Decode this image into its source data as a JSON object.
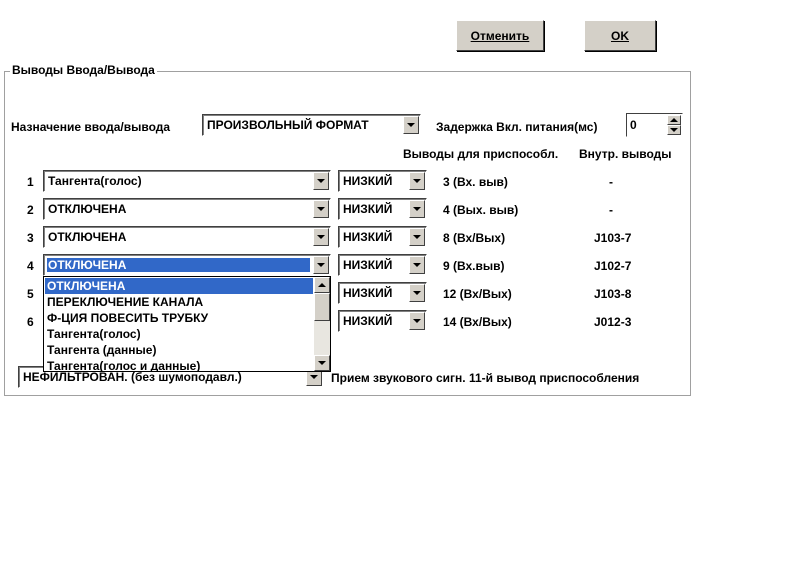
{
  "buttons": {
    "cancel": "Отменить",
    "ok": "OK"
  },
  "group_title": "Выводы Ввода/Вывода",
  "io_purpose": {
    "label": "Назначение ввода/вывода",
    "value": "ПРОИЗВОЛЬНЫЙ ФОРМАТ"
  },
  "power_delay": {
    "label": "Задержка Вкл. питания(мс)",
    "value": "0"
  },
  "headers": {
    "device_pins": "Выводы для приспособл.",
    "internal_pins": "Внутр. выводы"
  },
  "rows": [
    {
      "num": "1",
      "function": "Тангента(голос)",
      "level": "НИЗКИЙ",
      "device_pin": "3  (Вх. выв)",
      "internal_pin": "-"
    },
    {
      "num": "2",
      "function": "ОТКЛЮЧЕНА",
      "level": "НИЗКИЙ",
      "device_pin": "4  (Вых. выв)",
      "internal_pin": "-"
    },
    {
      "num": "3",
      "function": "ОТКЛЮЧЕНА",
      "level": "НИЗКИЙ",
      "device_pin": "8  (Вх/Вых)",
      "internal_pin": "J103-7"
    },
    {
      "num": "4",
      "function": "ОТКЛЮЧЕНА",
      "level": "НИЗКИЙ",
      "device_pin": "9  (Вх.выв)",
      "internal_pin": "J102-7"
    },
    {
      "num": "5",
      "function": "",
      "level": "НИЗКИЙ",
      "device_pin": "12  (Вх/Вых)",
      "internal_pin": "J103-8"
    },
    {
      "num": "6",
      "function": "",
      "level": "НИЗКИЙ",
      "device_pin": "14  (Вх/Вых)",
      "internal_pin": "J012-3"
    }
  ],
  "dropdown": {
    "items": [
      "ОТКЛЮЧЕНА",
      "ПЕРЕКЛЮЧЕНИЕ КАНАЛА",
      "Ф-ЦИЯ ПОВЕСИТЬ ТРУБКУ",
      "Тангента(голос)",
      "Тангента (данные)",
      "Тангента(голос и данные)"
    ]
  },
  "audio_filter": {
    "value": "НЕФИЛЬТРОВАН. (без шумоподавл.)",
    "label": "Прием звукового сигн.  11-й вывод приспособления"
  }
}
